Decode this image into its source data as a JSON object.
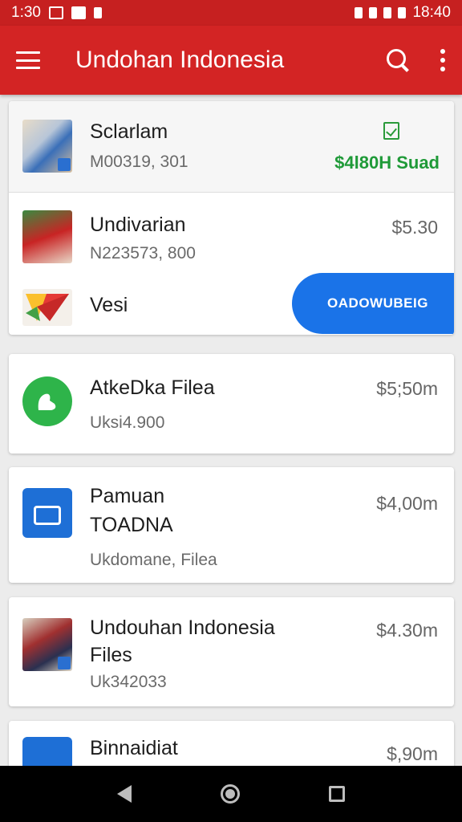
{
  "status_bar": {
    "time": "1:30",
    "clock": "18:40"
  },
  "app_bar": {
    "title": "Undohan Indonesia"
  },
  "card1": {
    "items": [
      {
        "name": "Sclarlam",
        "sub": "M00319, 301",
        "status": "$4l80H Suad"
      },
      {
        "name": "Undivarian",
        "sub": "N223573, 800",
        "price": "$5.30"
      },
      {
        "name": "Vesi"
      }
    ],
    "download_label": "OADOWUBEIG"
  },
  "card2": {
    "name": "AtkeDka Filea",
    "sub": "Uksi4.900",
    "price": "$5;50m"
  },
  "card3": {
    "name": "Pamuan",
    "name2": "TOADNA",
    "sub": "Ukdomane, Filea",
    "price": "$4,00m"
  },
  "card4": {
    "name": "Undouhan Indonesia",
    "name2": "Files",
    "sub": "Uk342033",
    "price": "$4.30m"
  },
  "card5": {
    "name": "Binnaidiat",
    "price": "$,90m"
  },
  "colors": {
    "app_bar": "#d32424",
    "accent_blue": "#1a73e8",
    "status_green": "#1f9a38"
  }
}
